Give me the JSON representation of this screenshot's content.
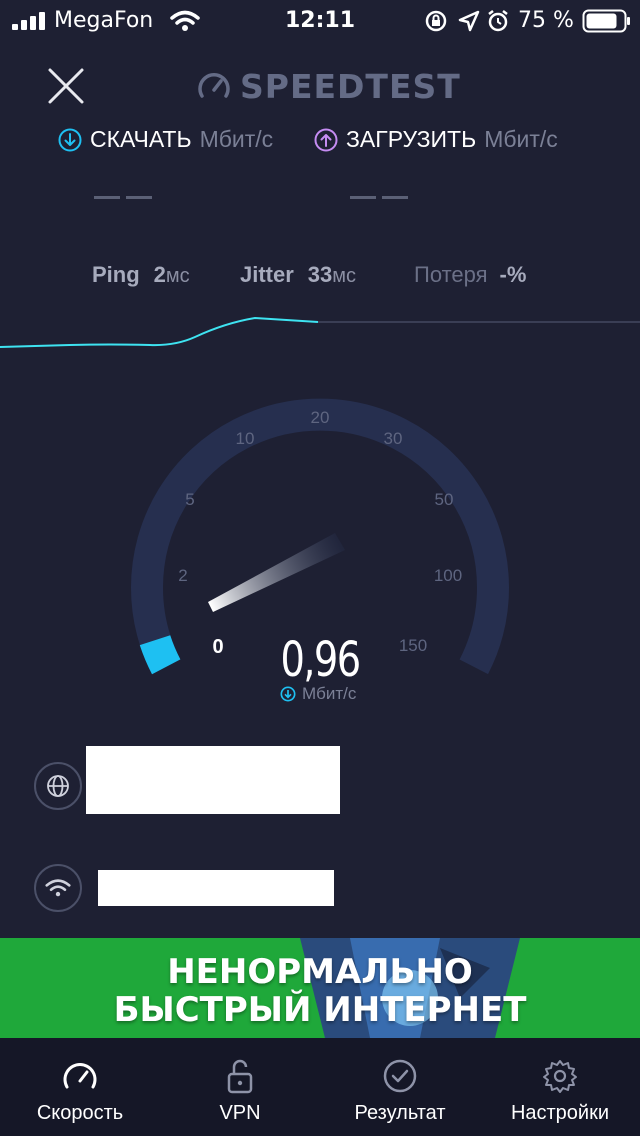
{
  "status_bar": {
    "carrier": "MegaFon",
    "time": "12:11",
    "battery": "75 %"
  },
  "header": {
    "brand": "SPEEDTEST"
  },
  "download": {
    "label": "СКАЧАТЬ",
    "unit": "Мбит/с"
  },
  "upload": {
    "label": "ЗАГРУЗИТЬ",
    "unit": "Мбит/с"
  },
  "metrics": {
    "ping_label": "Ping",
    "ping_value": "2",
    "ping_unit": "мс",
    "jitter_label": "Jitter",
    "jitter_value": "33",
    "jitter_unit": "мс",
    "loss_label": "Потеря",
    "loss_value": "-%"
  },
  "gauge": {
    "ticks": [
      "0",
      "2",
      "5",
      "10",
      "20",
      "30",
      "50",
      "100",
      "150"
    ],
    "speed": "0,96",
    "unit": "Мбит/с"
  },
  "banner": {
    "line1": "НЕНОРМАЛЬНО",
    "line2": "БЫСТРЫЙ ИНТЕРНЕТ"
  },
  "tabs": [
    {
      "label": "Скорость"
    },
    {
      "label": "VPN"
    },
    {
      "label": "Результат"
    },
    {
      "label": "Настройки"
    }
  ],
  "colors": {
    "background": "#1e2033",
    "accent_cyan": "#1ec0f2",
    "upload_purple": "#c58cf2",
    "gauge_track": "#262f4f",
    "banner_green": "#1fa83a"
  }
}
